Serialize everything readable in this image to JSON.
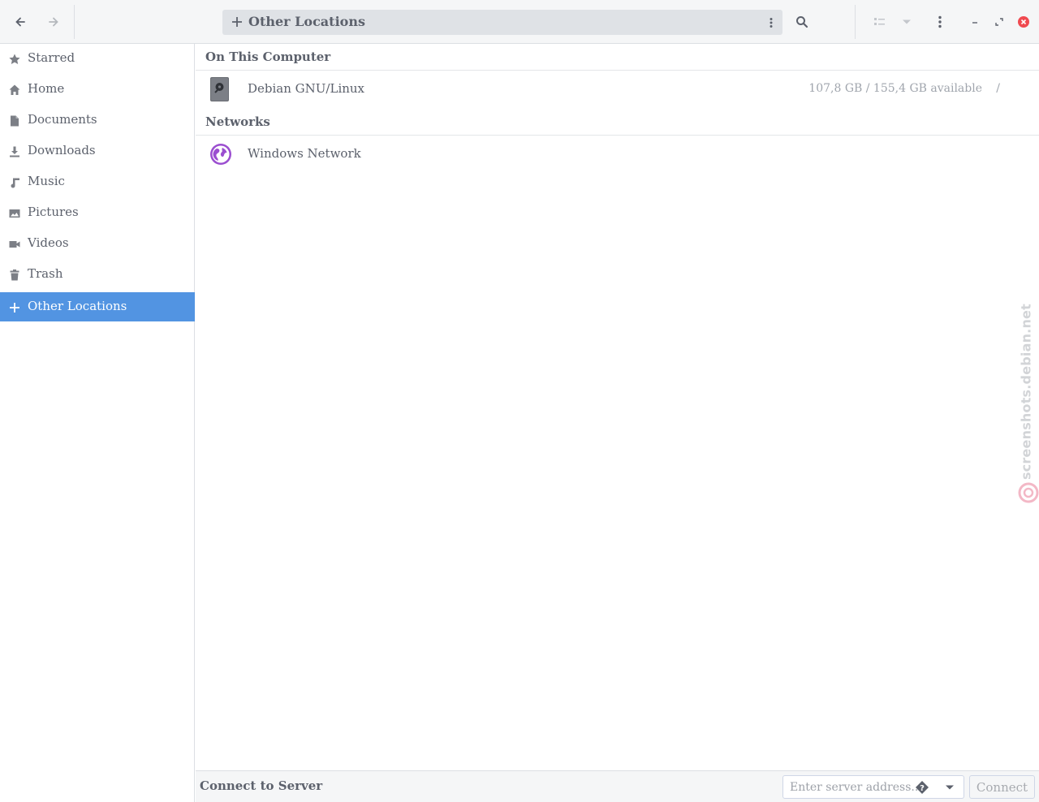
{
  "header": {
    "location_label": "Other Locations"
  },
  "sidebar": {
    "items": [
      {
        "label": "Starred",
        "icon": "star-icon"
      },
      {
        "label": "Home",
        "icon": "home-icon"
      },
      {
        "label": "Documents",
        "icon": "document-icon"
      },
      {
        "label": "Downloads",
        "icon": "download-icon"
      },
      {
        "label": "Music",
        "icon": "music-icon"
      },
      {
        "label": "Pictures",
        "icon": "picture-icon"
      },
      {
        "label": "Videos",
        "icon": "video-icon"
      },
      {
        "label": "Trash",
        "icon": "trash-icon"
      },
      {
        "label": "Other Locations",
        "icon": "plus-icon",
        "active": true
      }
    ]
  },
  "main": {
    "on_this_computer": {
      "heading": "On This Computer",
      "items": [
        {
          "name": "Debian GNU/Linux",
          "info": "107,8 GB / 155,4 GB available",
          "path": "/",
          "icon": "drive-icon"
        }
      ]
    },
    "networks": {
      "heading": "Networks",
      "items": [
        {
          "name": "Windows Network",
          "icon": "network-globe-icon"
        }
      ]
    }
  },
  "bottom": {
    "connect_to_server_label": "Connect to Server",
    "server_placeholder": "Enter server address...",
    "connect_label": "Connect"
  },
  "watermark": {
    "text": "screenshots.debian.net"
  },
  "colors": {
    "accent": "#5294e2",
    "close": "#f04a50",
    "network_icon": "#9b4ed0"
  }
}
